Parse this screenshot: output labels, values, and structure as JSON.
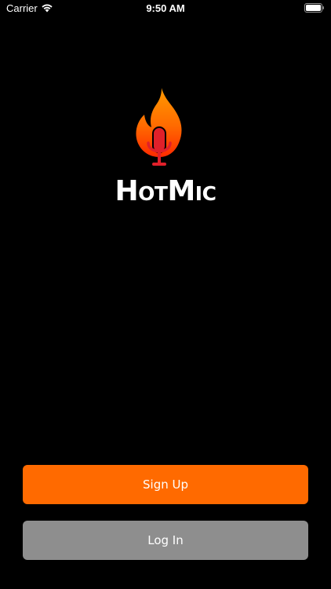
{
  "status_bar": {
    "carrier": "Carrier",
    "time": "9:50 AM",
    "wifi_icon": "wifi-icon",
    "battery_icon": "battery-icon"
  },
  "logo": {
    "word": "HotMic",
    "mark_icon": "flame-microphone-icon",
    "flame_top_color": "#ff7a00",
    "flame_bottom_color": "#ff2a00",
    "mic_color": "#e0202a"
  },
  "buttons": {
    "sign_up": {
      "label": "Sign Up",
      "color": "#ff6a00"
    },
    "log_in": {
      "label": "Log In",
      "color": "#8e8e8e"
    }
  }
}
